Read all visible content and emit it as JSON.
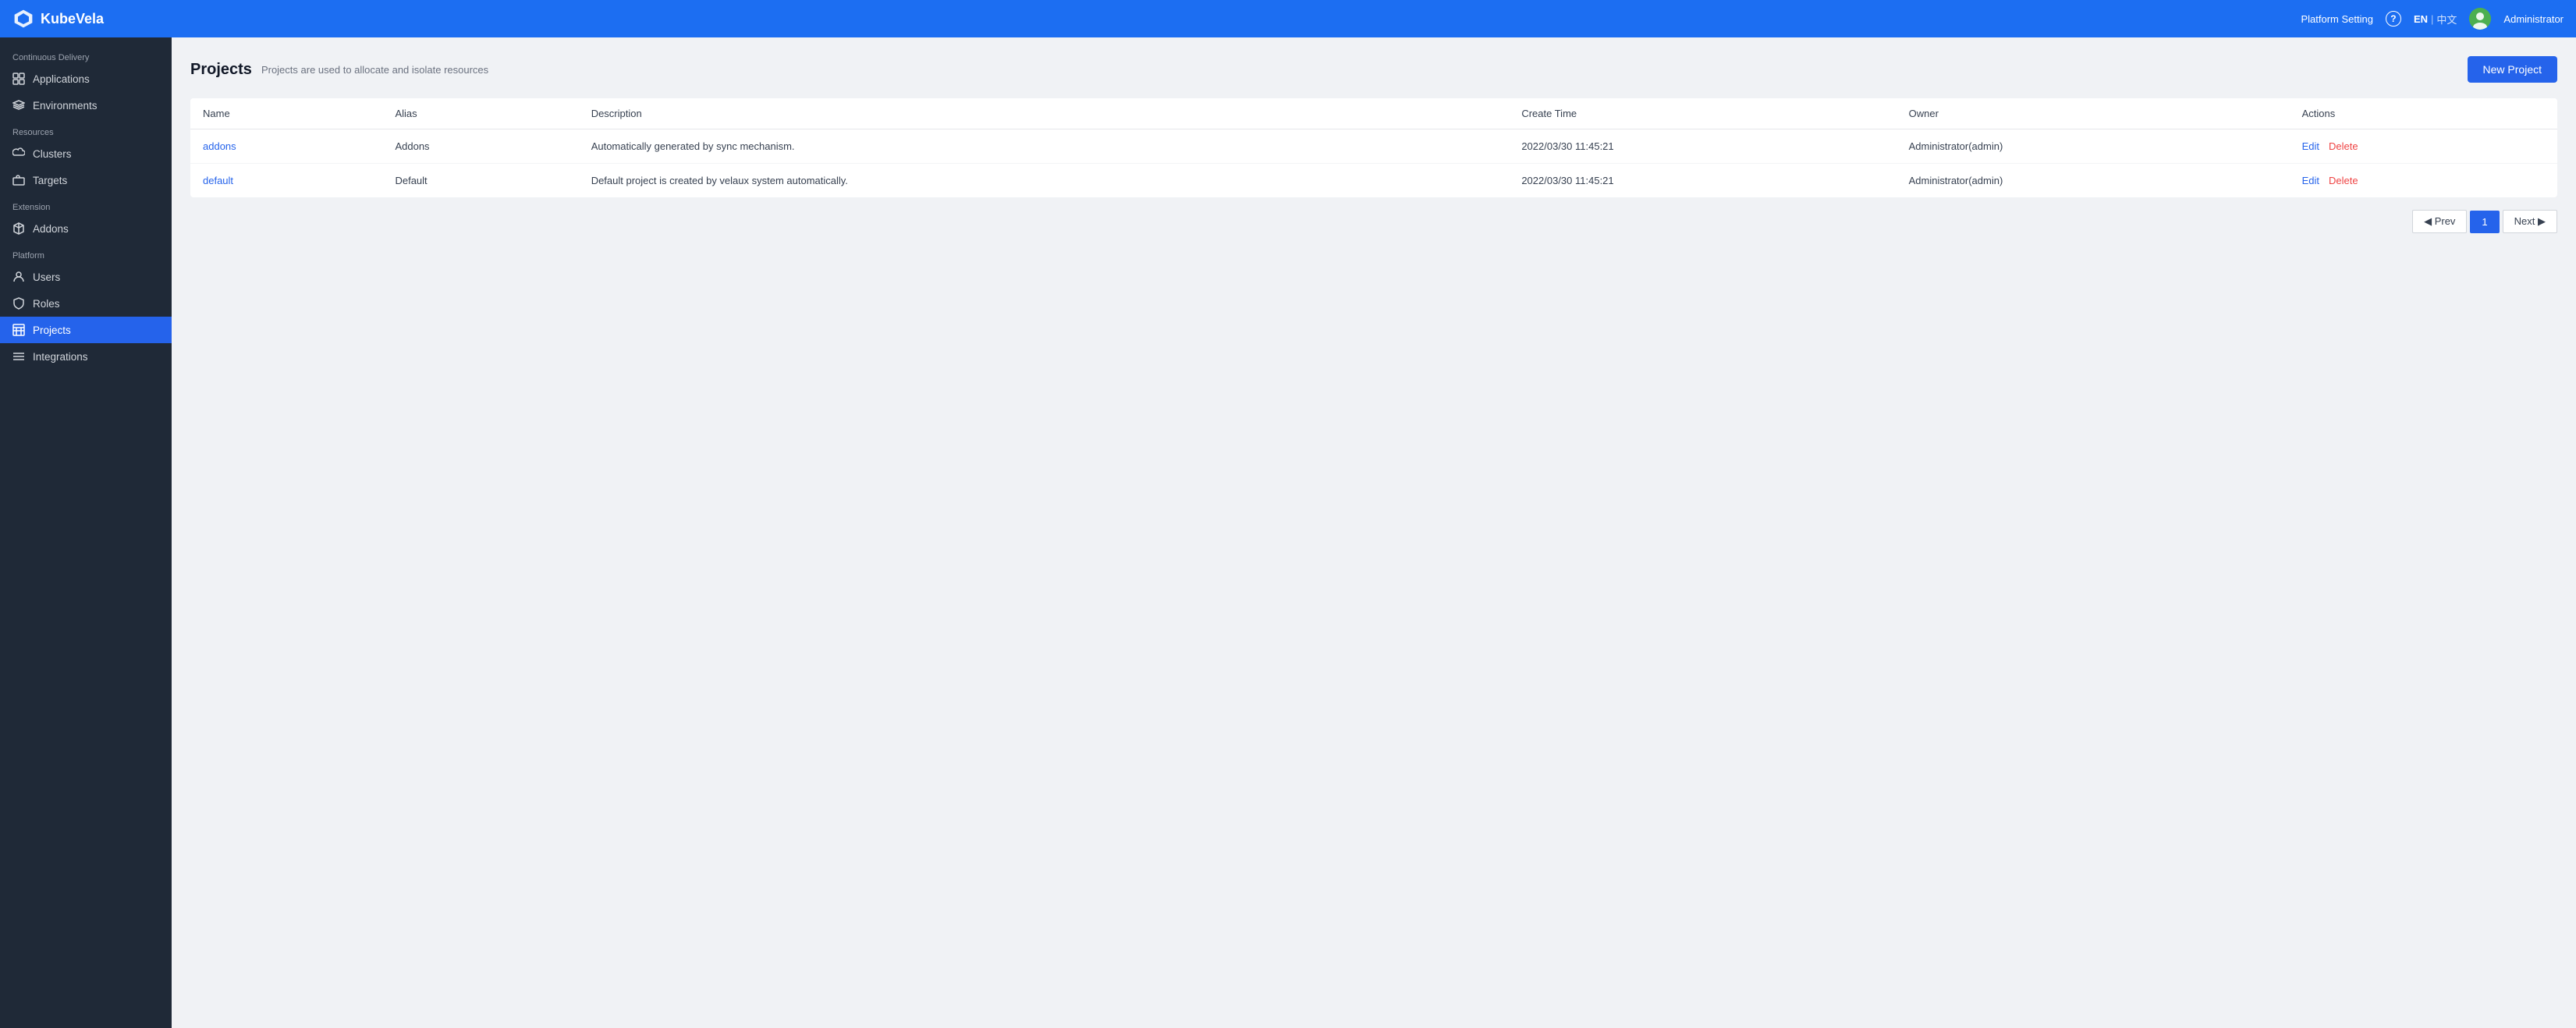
{
  "header": {
    "logo_text": "KubeVela",
    "platform_setting": "Platform Setting",
    "help_label": "?",
    "lang_en": "EN",
    "lang_sep": "|",
    "lang_zh": "中文",
    "user_name": "Administrator"
  },
  "sidebar": {
    "sections": [
      {
        "label": "Continuous Delivery",
        "items": [
          {
            "id": "applications",
            "label": "Applications",
            "icon": "grid"
          },
          {
            "id": "environments",
            "label": "Environments",
            "icon": "layers"
          }
        ]
      },
      {
        "label": "Resources",
        "items": [
          {
            "id": "clusters",
            "label": "Clusters",
            "icon": "cloud"
          },
          {
            "id": "targets",
            "label": "Targets",
            "icon": "briefcase"
          }
        ]
      },
      {
        "label": "Extension",
        "items": [
          {
            "id": "addons",
            "label": "Addons",
            "icon": "package"
          }
        ]
      },
      {
        "label": "Platform",
        "items": [
          {
            "id": "users",
            "label": "Users",
            "icon": "user"
          },
          {
            "id": "roles",
            "label": "Roles",
            "icon": "shield"
          },
          {
            "id": "projects",
            "label": "Projects",
            "icon": "table",
            "active": true
          },
          {
            "id": "integrations",
            "label": "Integrations",
            "icon": "menu"
          }
        ]
      }
    ]
  },
  "main": {
    "page_title": "Projects",
    "page_subtitle": "Projects are used to allocate and isolate resources",
    "new_project_btn": "New Project",
    "table": {
      "columns": [
        "Name",
        "Alias",
        "Description",
        "Create Time",
        "Owner",
        "Actions"
      ],
      "rows": [
        {
          "name": "addons",
          "alias": "Addons",
          "description": "Automatically generated by sync mechanism.",
          "create_time": "2022/03/30 11:45:21",
          "owner": "Administrator(admin)",
          "edit_label": "Edit",
          "delete_label": "Delete"
        },
        {
          "name": "default",
          "alias": "Default",
          "description": "Default project is created by velaux system automatically.",
          "create_time": "2022/03/30 11:45:21",
          "owner": "Administrator(admin)",
          "edit_label": "Edit",
          "delete_label": "Delete"
        }
      ]
    },
    "pagination": {
      "prev_label": "◀ Prev",
      "next_label": "Next ▶",
      "current_page": "1"
    }
  }
}
